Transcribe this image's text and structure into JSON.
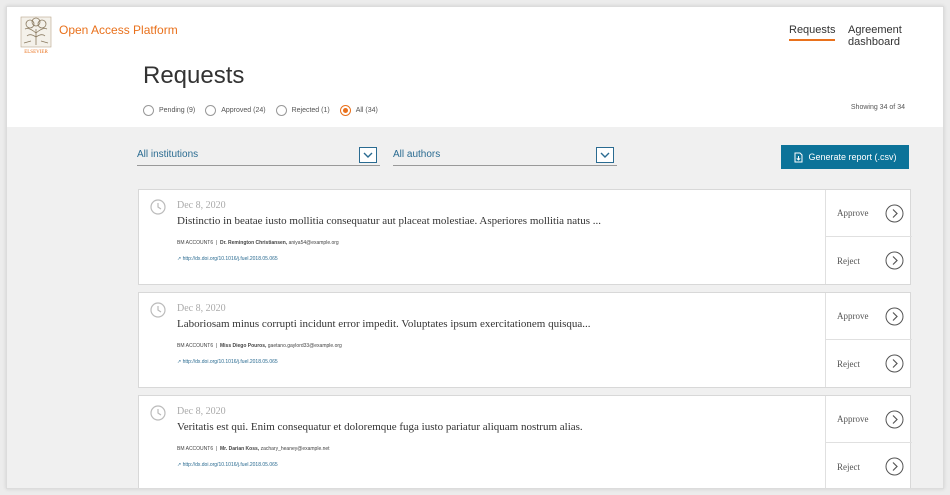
{
  "header": {
    "app_title": "Open Access Platform",
    "nav": [
      {
        "label": "Requests",
        "active": true
      },
      {
        "label": "Agreement dashboard",
        "active": false
      }
    ]
  },
  "page": {
    "title": "Requests",
    "showing": "Showing 34 of 34",
    "filters": [
      {
        "label": "Pending (9)",
        "checked": false
      },
      {
        "label": "Approved (24)",
        "checked": false
      },
      {
        "label": "Rejected (1)",
        "checked": false
      },
      {
        "label": "All (34)",
        "checked": true
      }
    ]
  },
  "toolbar": {
    "institutions_select": "All institutions",
    "authors_select": "All authors",
    "generate_report_label": "Generate report (.csv)"
  },
  "requests": [
    {
      "date": "Dec 8, 2020",
      "title": "Distinctio in beatae iusto mollitia consequatur aut placeat molestiae. Asperiores mollitia natus ...",
      "account": "BM ACCOUNT6",
      "author": "Dr. Remington Christiansen,",
      "email": "aniya54@example.org",
      "link": "http://dx.doi.org/10.1016/j.fuel.2018.05.065",
      "approve_label": "Approve",
      "reject_label": "Reject"
    },
    {
      "date": "Dec 8, 2020",
      "title": "Laboriosam minus corrupti incidunt error impedit. Voluptates ipsum exercitationem quisqua...",
      "account": "BM ACCOUNT6",
      "author": "Miss Diego Pouros,",
      "email": "gaetano.gaylord33@example.org",
      "link": "http://dx.doi.org/10.1016/j.fuel.2018.05.065",
      "approve_label": "Approve",
      "reject_label": "Reject"
    },
    {
      "date": "Dec 8, 2020",
      "title": "Veritatis est qui. Enim consequatur et doloremque fuga iusto pariatur aliquam nostrum alias.",
      "account": "BM ACCOUNT6",
      "author": "Mr. Darian Koss,",
      "email": "zachary_heaney@example.net",
      "link": "http://dx.doi.org/10.1016/j.fuel.2018.05.065",
      "approve_label": "Approve",
      "reject_label": "Reject"
    }
  ],
  "colors": {
    "accent": "#e9711c",
    "primary": "#0c7399",
    "link": "#2a6b91"
  },
  "icons": {
    "logo": "elsevier-tree-logo",
    "select": "chevron-down-icon",
    "report": "download-report-icon",
    "date": "clock-icon",
    "action": "chevron-right-circle-icon",
    "link": "external-link-icon"
  }
}
